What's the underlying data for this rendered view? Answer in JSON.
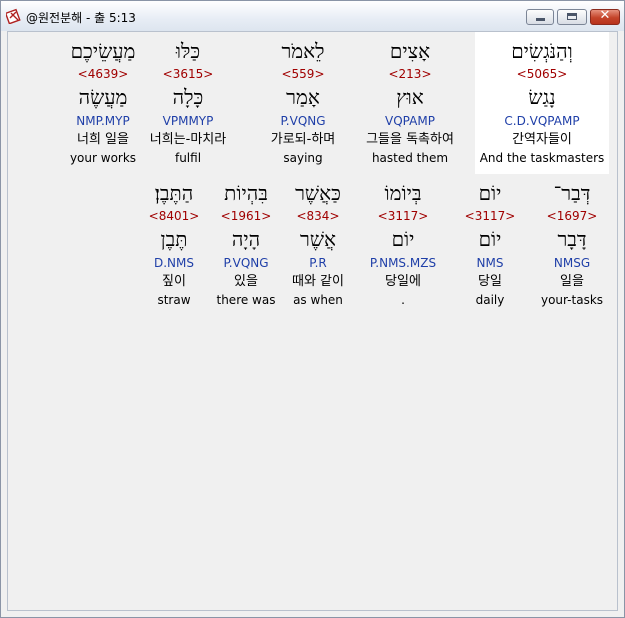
{
  "window": {
    "title": "@원전분해 - 출 5:13",
    "icon": "bible-app-icon",
    "controls": [
      "minimize",
      "maximize",
      "close"
    ]
  },
  "rows": [
    {
      "words": [
        {
          "hebrew": "וְהַנֹּגְשִׂים",
          "strong": "<5065>",
          "lemma": "נָגַשׂ",
          "parse": "C.D.VQPAMP",
          "korean": "간역자들이",
          "english": "And the taskmasters",
          "selected": true
        },
        {
          "hebrew": "אָצִים",
          "strong": "<213>",
          "lemma": "אוּץ",
          "parse": "VQPAMP",
          "korean": "그들을 독촉하여",
          "english": "hasted them",
          "selected": false
        },
        {
          "hebrew": "לֵאמֹר",
          "strong": "<559>",
          "lemma": "אָמַר",
          "parse": "P.VQNG",
          "korean": "가로되-하며",
          "english": "saying",
          "selected": false
        },
        {
          "hebrew": "כַּלּוּ",
          "strong": "<3615>",
          "lemma": "כָּלָה",
          "parse": "VPMMYP",
          "korean": "너희는-마치라",
          "english": "fulfil",
          "selected": false
        },
        {
          "hebrew": "מַעֲשֵׂיכֶם",
          "strong": "<4639>",
          "lemma": "מַעֲשֶׂה",
          "parse": "NMP.MYP",
          "korean": "너희 일을",
          "english": "your works",
          "selected": false
        }
      ]
    },
    {
      "words": [
        {
          "hebrew": "דְּבַר־",
          "strong": "<1697>",
          "lemma": "דָּבָר",
          "parse": "NMSG",
          "korean": "일을",
          "english": "your-tasks",
          "selected": false
        },
        {
          "hebrew": "יוֹם",
          "strong": "<3117>",
          "lemma": "יוֹם",
          "parse": "NMS",
          "korean": "당일",
          "english": "daily",
          "selected": false
        },
        {
          "hebrew": "בְּיוֹמוֹ",
          "strong": "<3117>",
          "lemma": "יוֹם",
          "parse": "P.NMS.MZS",
          "korean": "당일에",
          "english": ".",
          "selected": false
        },
        {
          "hebrew": "כַּאֲשֶׁר",
          "strong": "<834>",
          "lemma": "אֲשֶׁר",
          "parse": "P.R",
          "korean": "때와 같이",
          "english": "as when",
          "selected": false
        },
        {
          "hebrew": "בִּהְיוֹת",
          "strong": "<1961>",
          "lemma": "הָיָה",
          "parse": "P.VQNG",
          "korean": "있을",
          "english": "there was",
          "selected": false
        },
        {
          "hebrew": "הַתֶּבֶן׃",
          "strong": "<8401>",
          "lemma": "תֶּבֶן",
          "parse": "D.NMS",
          "korean": "짚이",
          "english": "straw",
          "selected": false
        }
      ]
    }
  ]
}
